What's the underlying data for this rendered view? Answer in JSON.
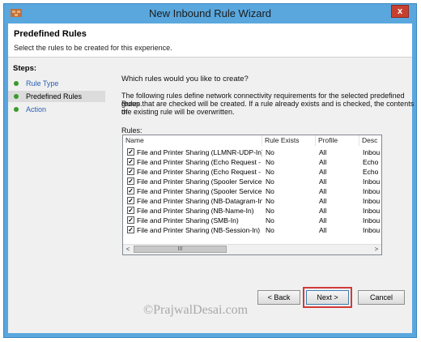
{
  "window": {
    "title": "New Inbound Rule Wizard",
    "close_label": "x"
  },
  "header": {
    "title": "Predefined Rules",
    "subtitle": "Select the rules to be created for this experience."
  },
  "steps": {
    "title": "Steps:",
    "items": [
      {
        "label": "Rule Type",
        "state": "done"
      },
      {
        "label": "Predefined Rules",
        "state": "current"
      },
      {
        "label": "Action",
        "state": "pending"
      }
    ]
  },
  "main": {
    "question": "Which rules would you like to create?",
    "description_lines": [
      "The following rules define network connectivity requirements for the selected predefined group.",
      "Rules that are checked will be created. If a rule already exists and is checked, the contents of",
      "the existing rule will be overwritten."
    ],
    "rules_label": "Rules:"
  },
  "table": {
    "columns": [
      "Name",
      "Rule Exists",
      "Profile",
      "Desc"
    ],
    "rows": [
      {
        "checked": true,
        "name": "File and Printer Sharing (LLMNR-UDP-In)",
        "exists": "No",
        "profile": "All",
        "desc": "Inbou"
      },
      {
        "checked": true,
        "name": "File and Printer Sharing (Echo Request - ICM...",
        "exists": "No",
        "profile": "All",
        "desc": "Echo"
      },
      {
        "checked": true,
        "name": "File and Printer Sharing (Echo Request - ICM...",
        "exists": "No",
        "profile": "All",
        "desc": "Echo"
      },
      {
        "checked": true,
        "name": "File and Printer Sharing (Spooler Service - RP...",
        "exists": "No",
        "profile": "All",
        "desc": "Inbou"
      },
      {
        "checked": true,
        "name": "File and Printer Sharing (Spooler Service - RPC)",
        "exists": "No",
        "profile": "All",
        "desc": "Inbou"
      },
      {
        "checked": true,
        "name": "File and Printer Sharing (NB-Datagram-In)",
        "exists": "No",
        "profile": "All",
        "desc": "Inbou"
      },
      {
        "checked": true,
        "name": "File and Printer Sharing (NB-Name-In)",
        "exists": "No",
        "profile": "All",
        "desc": "Inbou"
      },
      {
        "checked": true,
        "name": "File and Printer Sharing (SMB-In)",
        "exists": "No",
        "profile": "All",
        "desc": "Inbou"
      },
      {
        "checked": true,
        "name": "File and Printer Sharing (NB-Session-In)",
        "exists": "No",
        "profile": "All",
        "desc": "Inbou"
      }
    ],
    "scroll": {
      "left": "<",
      "right": ">",
      "thumb": "III"
    }
  },
  "buttons": {
    "back": "< Back",
    "next": "Next >",
    "cancel": "Cancel"
  },
  "watermark": "©PrajwalDesai.com",
  "colors": {
    "title_bar": "#5aa7de",
    "close_button": "#c7402f",
    "step_dot": "#3a9a2a",
    "step_link": "#2b5fb3",
    "highlight_outline": "#d33a3a"
  }
}
